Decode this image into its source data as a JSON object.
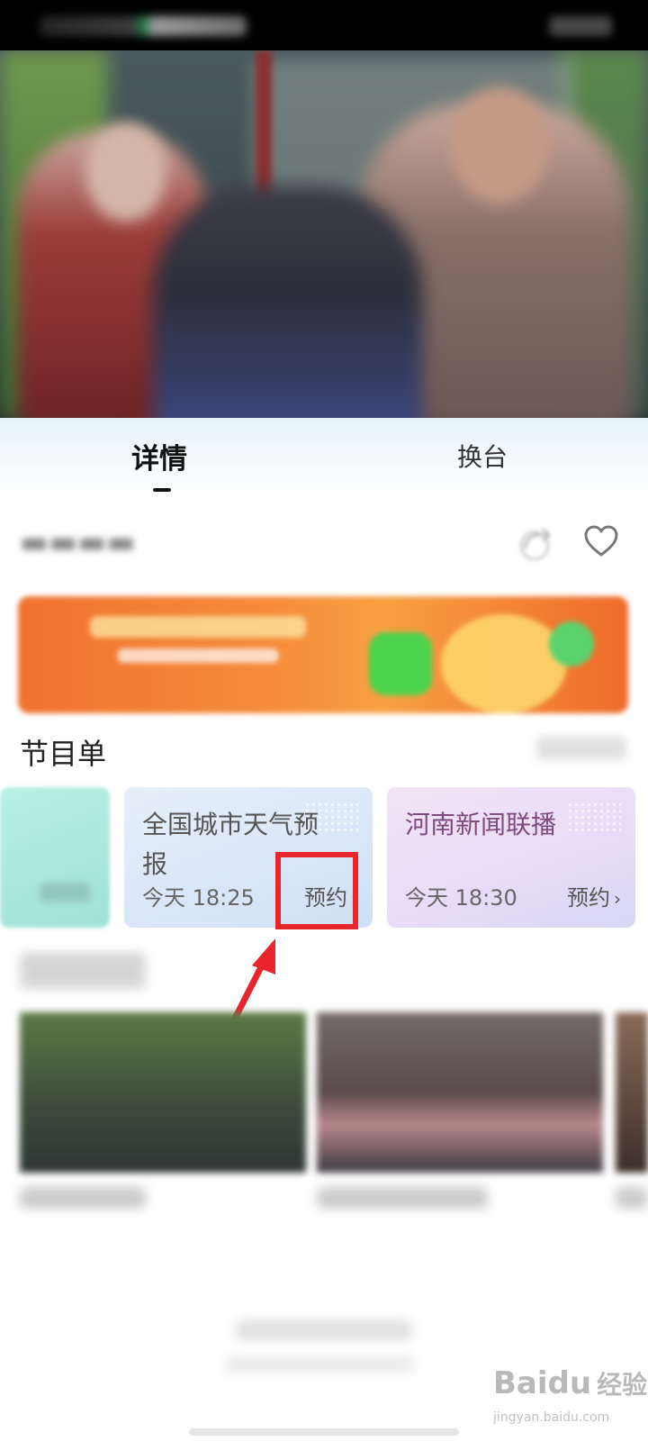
{
  "tabs": {
    "details": "详情",
    "switch_channel": "换台"
  },
  "schedule": {
    "title": "节目单",
    "items": [
      {
        "title": "全国城市天气预报",
        "time": "今天 18:25",
        "action": "预约"
      },
      {
        "title": "河南新闻联播",
        "time": "今天 18:30",
        "action": "预约"
      }
    ]
  },
  "icons": {
    "share": "share-icon",
    "favorite": "heart-icon",
    "chevron": "chevron-right-icon"
  },
  "colors": {
    "highlight": "#e8252c",
    "banner": "#f07330"
  },
  "watermark": {
    "brand": "Bai",
    "suffix": "du",
    "cn": "经验",
    "url": "jingyan.baidu.com"
  }
}
